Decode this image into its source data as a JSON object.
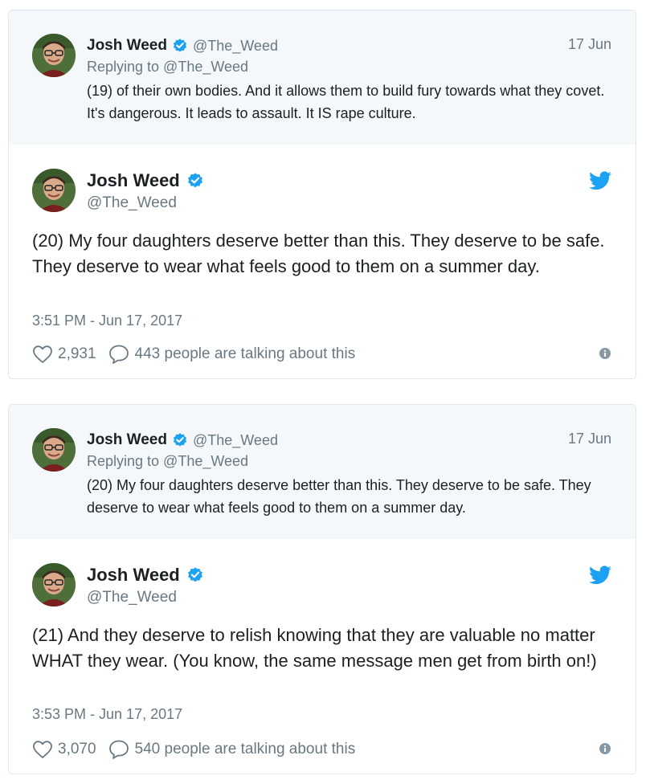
{
  "colors": {
    "twitter_blue": "#1da1f2",
    "muted": "#697882",
    "text": "#1c2022",
    "parent_bg": "#f5f8fa"
  },
  "icons": [
    "verified-badge-icon",
    "twitter-bird-icon",
    "heart-icon",
    "reply-bubble-icon",
    "info-icon"
  ],
  "tweets": [
    {
      "parent": {
        "name": "Josh Weed",
        "handle": "@The_Weed",
        "date": "17 Jun",
        "replying_to": "Replying to @The_Weed",
        "text": "(19) of their own bodies. And it allows them to build fury towards what they covet. It's dangerous. It leads to assault. It IS rape culture."
      },
      "main": {
        "name": "Josh Weed",
        "handle": "@The_Weed",
        "text": "(20) My four daughters deserve better than this. They deserve to be safe. They deserve to wear what feels good to them on a summer day.",
        "timestamp": "3:51 PM - Jun 17, 2017",
        "likes": "2,931",
        "talking": "443 people are talking about this"
      }
    },
    {
      "parent": {
        "name": "Josh Weed",
        "handle": "@The_Weed",
        "date": "17 Jun",
        "replying_to": "Replying to @The_Weed",
        "text": "(20) My four daughters deserve better than this. They deserve to be safe. They deserve to wear what feels good to them on a summer day."
      },
      "main": {
        "name": "Josh Weed",
        "handle": "@The_Weed",
        "text": "(21) And they deserve to relish knowing that they are valuable no matter WHAT they wear. (You know, the same message men get from birth on!)",
        "timestamp": "3:53 PM - Jun 17, 2017",
        "likes": "3,070",
        "talking": "540 people are talking about this"
      }
    }
  ]
}
